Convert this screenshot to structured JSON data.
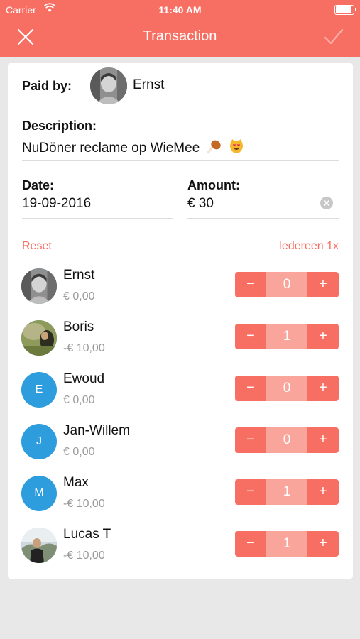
{
  "status_bar": {
    "carrier": "Carrier",
    "time": "11:40 AM"
  },
  "nav": {
    "title": "Transaction"
  },
  "form": {
    "paid_by_label": "Paid by:",
    "paid_by_name": "Ernst",
    "description_label": "Description:",
    "description_value": "NuDöner reclame op WieMee",
    "date_label": "Date:",
    "date_value": "19-09-2016",
    "amount_label": "Amount:",
    "amount_value": "€ 30"
  },
  "actions": {
    "reset": "Reset",
    "everyone": "Iedereen 1x"
  },
  "participants": [
    {
      "name": "Ernst",
      "amount": "€ 0,00",
      "count": "0",
      "avatar": "photo"
    },
    {
      "name": "Boris",
      "amount": "-€ 10,00",
      "count": "1",
      "avatar": "photo"
    },
    {
      "name": "Ewoud",
      "amount": "€ 0,00",
      "count": "0",
      "avatar": "E"
    },
    {
      "name": "Jan-Willem",
      "amount": "€ 0,00",
      "count": "0",
      "avatar": "J"
    },
    {
      "name": "Max",
      "amount": "-€ 10,00",
      "count": "1",
      "avatar": "M"
    },
    {
      "name": "Lucas T",
      "amount": "-€ 10,00",
      "count": "1",
      "avatar": "photo"
    }
  ],
  "stepper": {
    "minus": "−",
    "plus": "+"
  },
  "colors": {
    "accent": "#f76f62",
    "accent_light": "#f9a59c",
    "initial_avatar": "#2e9ddd"
  },
  "icons": [
    "wifi-icon",
    "battery-icon",
    "close-icon",
    "checkmark-icon",
    "clear-icon",
    "drumstick-emoji-icon",
    "heart-eyes-cat-emoji-icon"
  ]
}
